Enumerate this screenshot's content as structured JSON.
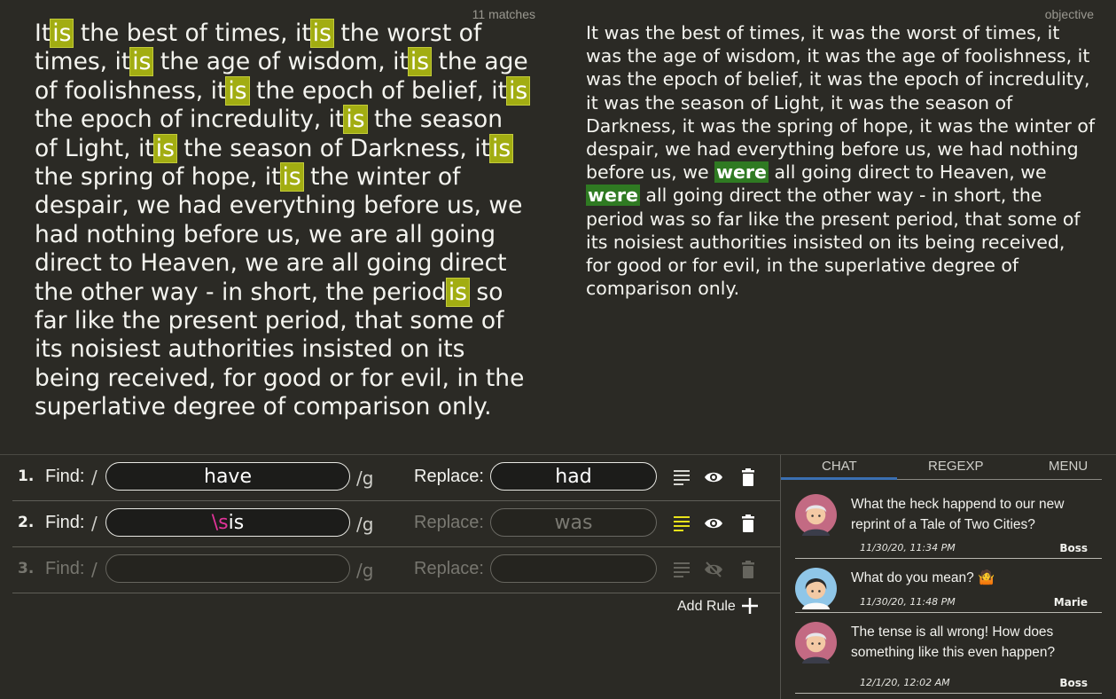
{
  "source": {
    "match_count": "11 matches",
    "segments": [
      {
        "t": "It"
      },
      {
        "t": "is",
        "h": 1
      },
      {
        "t": " the best of times, it"
      },
      {
        "t": "is",
        "h": 1
      },
      {
        "t": " the worst of times, it"
      },
      {
        "t": "is",
        "h": 1
      },
      {
        "t": " the age of wisdom, it"
      },
      {
        "t": "is",
        "h": 1
      },
      {
        "t": " the age of foolishness, it"
      },
      {
        "t": "is",
        "h": 1
      },
      {
        "t": " the epoch of belief, it"
      },
      {
        "t": "is",
        "h": 1
      },
      {
        "t": " the epoch of incredulity, it"
      },
      {
        "t": "is",
        "h": 1
      },
      {
        "t": " the season of Light, it"
      },
      {
        "t": "is",
        "h": 1
      },
      {
        "t": " the season of Darkness, it"
      },
      {
        "t": "is",
        "h": 1
      },
      {
        "t": " the spring of hope, it"
      },
      {
        "t": "is",
        "h": 1
      },
      {
        "t": " the winter of despair, we had everything before us, we had nothing before us, we are all going direct to Heaven, we are all going direct the other way - in short, the period"
      },
      {
        "t": "is",
        "h": 1
      },
      {
        "t": " so far like the present period, that some of its noisiest authorities insisted on its being received, for good or for evil, in the superlative degree of comparison only."
      }
    ]
  },
  "objective": {
    "label": "objective",
    "segments": [
      {
        "t": "It was the best of times, it was the worst of times, it was the age of wisdom, it was the age of foolishness, it was the epoch of belief, it was the epoch of incredulity, it was the season of Light, it was the season of Darkness, it was the spring of hope, it was the winter of despair, we had everything before us, we had nothing before us, we "
      },
      {
        "t": "were",
        "h": 1
      },
      {
        "t": " all going direct to Heaven, we "
      },
      {
        "t": "were",
        "h": 1
      },
      {
        "t": " all going direct the other way - in short, the period was so far like the present period, that some of its noisiest authorities insisted on its being received, for good or for evil, in the superlative degree of comparison only."
      }
    ]
  },
  "rules": {
    "find_label": "Find:",
    "replace_label": "Replace:",
    "slash": "/",
    "flag": "/g",
    "add_rule_label": "Add Rule",
    "items": [
      {
        "num": "1.",
        "find": "have",
        "replace": "had"
      },
      {
        "num": "2.",
        "find_meta": "\\s",
        "find_rest": "is",
        "replace": "was"
      },
      {
        "num": "3.",
        "find": "",
        "replace": ""
      }
    ]
  },
  "chat": {
    "tabs": [
      "CHAT",
      "REGEXP",
      "MENU"
    ],
    "messages": [
      {
        "text": "What the heck happend to our new reprint of a Tale of Two Cities?",
        "time": "11/30/20, 11:34 PM",
        "author": "Boss"
      },
      {
        "text": "What do you mean? 🤷",
        "time": "11/30/20, 11:48 PM",
        "author": "Marie"
      },
      {
        "text": "The tense is all wrong! How does something like this even happen?",
        "time": "12/1/20, 12:02 AM",
        "author": "Boss"
      }
    ]
  },
  "colors": {
    "background": "#2b2a25",
    "match_highlight": "#a2ad12",
    "objective_highlight": "#2f7a22",
    "regex_meta": "#e2339a",
    "active_tab": "#3a6fb2"
  }
}
